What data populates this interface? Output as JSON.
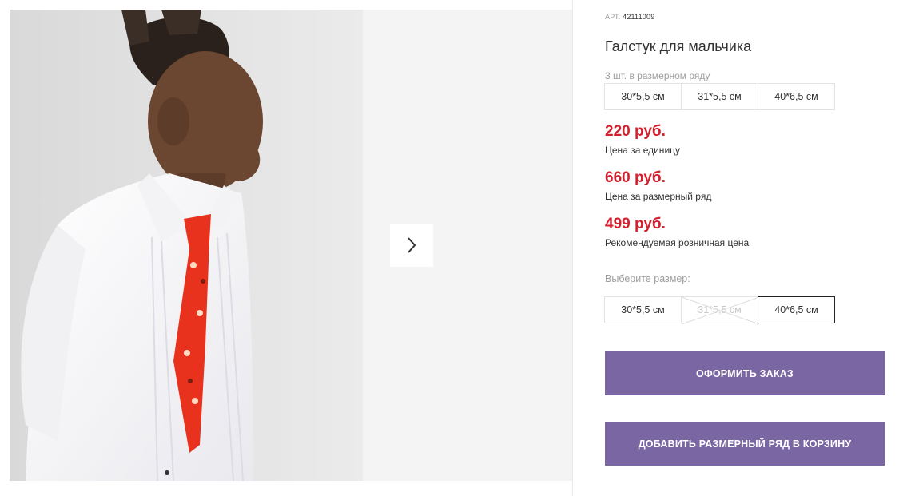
{
  "product": {
    "article_label": "АРТ.",
    "article_number": "42111009",
    "title": "Галстук для мальчика",
    "pack_note": "3 шт. в размерном ряду",
    "pack_sizes": [
      "30*5,5 см",
      "31*5,5 см",
      "40*6,5 см"
    ]
  },
  "prices": [
    {
      "amount": "220 руб.",
      "label": "Цена за единицу"
    },
    {
      "amount": "660 руб.",
      "label": "Цена за размерный ряд"
    },
    {
      "amount": "499 руб.",
      "label": "Рекомендуемая розничная цена"
    }
  ],
  "size_select": {
    "label": "Выберите размер:",
    "options": [
      {
        "text": "30*5,5 см",
        "state": "available"
      },
      {
        "text": "31*5,5 см",
        "state": "unavailable"
      },
      {
        "text": "40*6,5 см",
        "state": "selected"
      }
    ]
  },
  "actions": {
    "order_label": "ОФОРМИТЬ ЗАКАЗ",
    "add_to_cart_label": "ДОБАВИТЬ РАЗМЕРНЫЙ РЯД В КОРЗИНУ"
  },
  "gallery": {
    "next_icon": "chevron-right-icon"
  },
  "colors": {
    "price": "#d2202f",
    "button": "#7a66a3",
    "selected_border": "#222222"
  }
}
